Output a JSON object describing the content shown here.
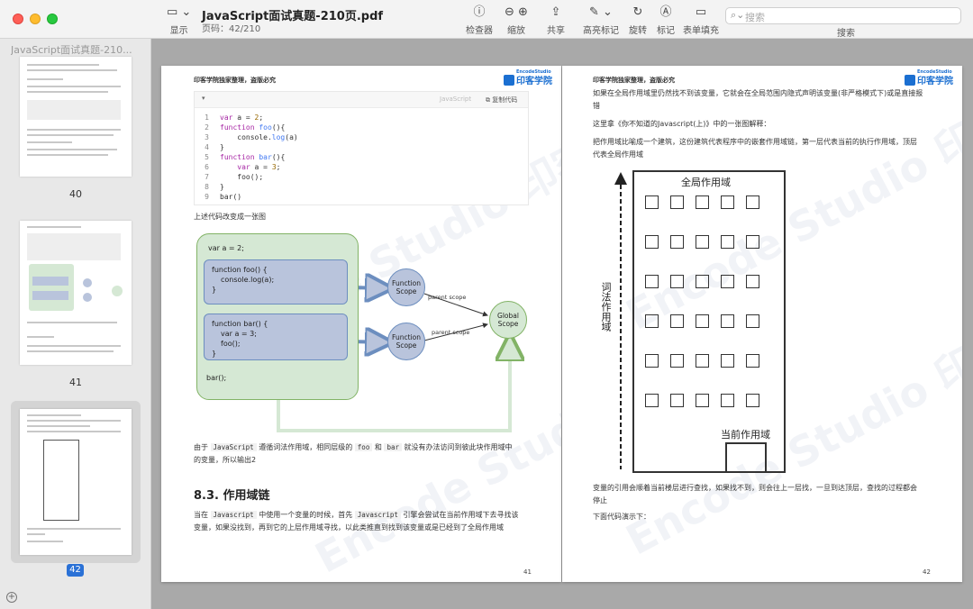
{
  "toolbar": {
    "sidebar_toggle_label": "显示",
    "doc_title": "JavaScript面试真题-210页.pdf",
    "page_indicator": "页码：42/210",
    "inspector_label": "检查器",
    "zoom_label": "缩放",
    "share_label": "共享",
    "highlight_label": "高亮标记",
    "rotate_label": "旋转",
    "markup_label": "标记",
    "form_fill_label": "表单填充",
    "search_placeholder": "搜索",
    "search_label": "搜索"
  },
  "sidebar": {
    "title": "JavaScript面试真题-210...",
    "pages": [
      {
        "label": "40"
      },
      {
        "label": "41"
      },
      {
        "label": "42",
        "selected": true
      }
    ],
    "add_label": "+"
  },
  "page_left": {
    "header": "印客学院独家整理，盗版必究",
    "logo_top": "EncodeStudio",
    "logo_text": "印客学院",
    "code_lang": "JavaScript",
    "code_copy": "复制代码",
    "code_lines": [
      {
        "n": "1",
        "text": "var a = 2;"
      },
      {
        "n": "2",
        "text": "function foo(){"
      },
      {
        "n": "3",
        "text": "    console.log(a)"
      },
      {
        "n": "4",
        "text": "}"
      },
      {
        "n": "5",
        "text": "function bar(){"
      },
      {
        "n": "6",
        "text": "    var a = 3;"
      },
      {
        "n": "7",
        "text": "    foo();"
      },
      {
        "n": "8",
        "text": "}"
      },
      {
        "n": "9",
        "text": "bar()"
      }
    ],
    "caption_before": "上述代码改变成一张图",
    "diagram": {
      "var_line": "var a = 2;",
      "foo_box": [
        "function foo() {",
        "  console.log(a);",
        "}"
      ],
      "bar_box": [
        "function bar() {",
        "  var a = 3;",
        "  foo();",
        "}"
      ],
      "bar_call": "bar();",
      "function_scope": "Function Scope",
      "global_scope": "Global Scope",
      "parent_scope": "parent scope"
    },
    "para1_parts": [
      "由于 ",
      "JavaScript",
      " 遵循词法作用域，相同层级的 ",
      "foo",
      " 和 ",
      "bar",
      " 就没有办法访问到彼此块作用域中"
    ],
    "para1_line2": "的变量，所以输出2",
    "section_title": "8.3. 作用域链",
    "para2_parts": [
      "当在 ",
      "Javascript",
      " 中使用一个变量的时候，首先 ",
      "Javascript",
      " 引擎会尝试在当前作用域下去寻找该"
    ],
    "para2_line2": "变量，如果没找到，再到它的上层作用域寻找，以此类推直到找到该变量或是已经到了全局作用域",
    "page_number": "41"
  },
  "page_right": {
    "header": "印客学院独家整理，盗版必究",
    "logo_top": "EncodeStudio",
    "logo_text": "印客学院",
    "para1_line1": "如果在全局作用域里仍然找不到该变量，它就会在全局范围内隐式声明该变量(非严格模式下)或是直接报",
    "para1_line2": "错",
    "para2": "这里拿《你不知道的Javascript(上)》中的一张图解释：",
    "para3_line1": "把作用域比喻成一个建筑，这份建筑代表程序中的嵌套作用域链，第一层代表当前的执行作用域，顶层",
    "para3_line2": "代表全局作用域",
    "building": {
      "top_label": "全局作用域",
      "bottom_label": "当前作用域",
      "side_label": "词法作用域"
    },
    "para4_line1": "变量的引用会顺着当前楼层进行查找，如果找不到，则会往上一层找，一旦到达顶层，查找的过程都会",
    "para4_line2": "停止",
    "para5": "下面代码演示下：",
    "page_number": "42"
  },
  "watermark": "Encode Studio 印客学院"
}
